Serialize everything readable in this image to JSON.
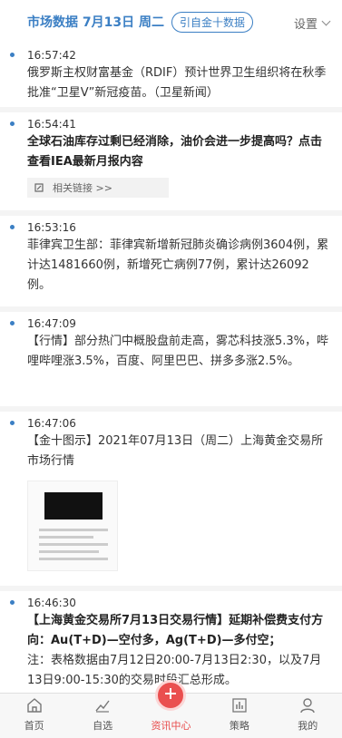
{
  "header": {
    "title": "市场数据  7月13日 周二",
    "source_badge": "引自金十数据",
    "settings_label": "设置"
  },
  "items": [
    {
      "time": "16:57:42",
      "content": "俄罗斯主权财富基金（RDIF）预计世界卫生组织将在秋季批准“卫星V”新冠疫苗。（卫星新闻）"
    },
    {
      "time": "16:54:41",
      "content": "全球石油库存过剩已经消除，油价会进一步提高吗？点击查看IEA最新月报内容",
      "related": "相关链接 >>"
    },
    {
      "time": "16:53:16",
      "content": "菲律宾卫生部：菲律宾新增新冠肺炎确诊病例3604例，累计达1481660例，新增死亡病例77例，累计达26092例。"
    },
    {
      "time": "16:47:09",
      "content": "【行情】部分热门中概股盘前走高，雾芯科技涨5.3%，哔哩哔哩涨3.5%，百度、阿里巴巴、拼多多涨2.5%。"
    },
    {
      "time": "16:47:06",
      "content": "【金十图示】2021年07月13日（周二）上海黄金交易所市场行情"
    },
    {
      "time": "16:46:30",
      "content_bold": "【上海黄金交易所7月13日交易行情】延期补偿费支付方向：Au(T+D)—空付多，Ag(T+D)—多付空；",
      "content": "注：表格数据由7月12日20:00-7月13日2:30，以及7月13日9:00-15:30的交易时段汇总形成。"
    }
  ],
  "tabbar": [
    {
      "label": "首页",
      "icon": "home-icon"
    },
    {
      "label": "自选",
      "icon": "trend-icon"
    },
    {
      "label": "资讯中心",
      "icon": "plus-icon",
      "active": true
    },
    {
      "label": "策略",
      "icon": "bar-chart-icon"
    },
    {
      "label": "我的",
      "icon": "user-icon"
    }
  ],
  "colors": {
    "accent": "#3b7fc4",
    "active_tab": "#e84a4a"
  }
}
